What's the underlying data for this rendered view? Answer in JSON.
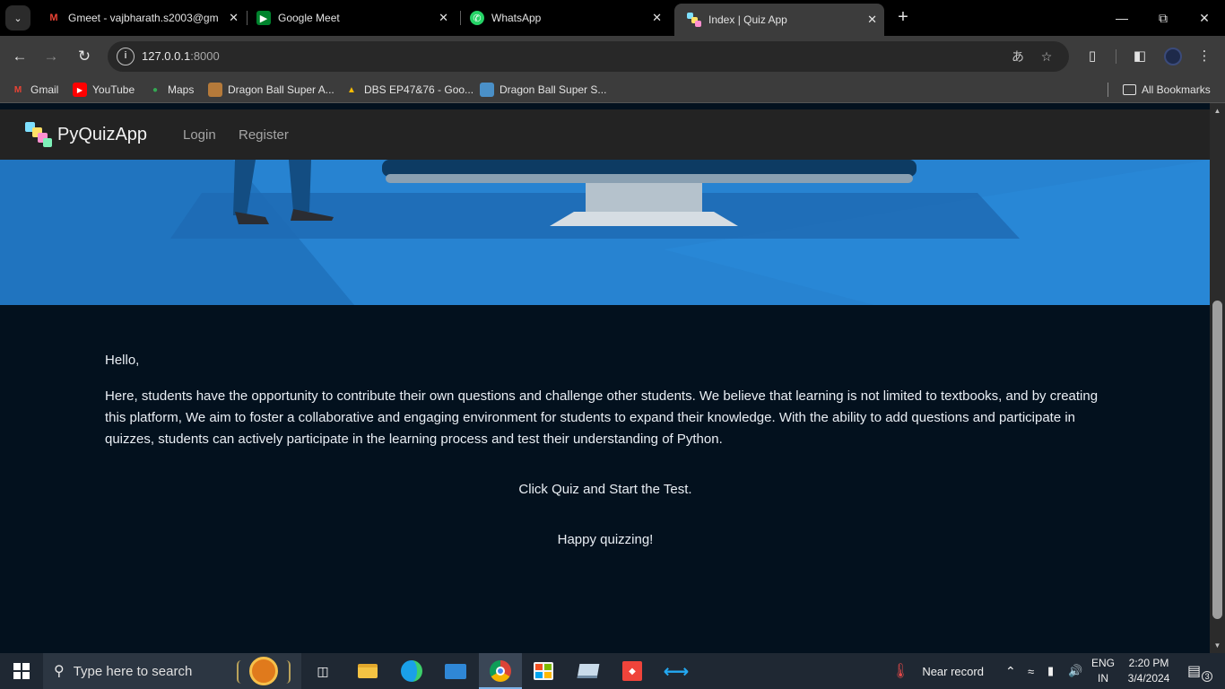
{
  "browser": {
    "tabs": [
      {
        "title": "Gmeet - vajbharath.s2003@gma",
        "favicon": "gmail-icon",
        "active": false
      },
      {
        "title": "Google Meet",
        "favicon": "google-meet-icon",
        "active": false
      },
      {
        "title": "WhatsApp",
        "favicon": "whatsapp-icon",
        "active": false
      },
      {
        "title": "Index | Quiz App",
        "favicon": "quiz-app-icon",
        "active": true
      }
    ],
    "address": {
      "host": "127.0.0.1",
      "port": ":8000"
    },
    "bookmarks": [
      {
        "label": "Gmail",
        "icon": "gmail-icon"
      },
      {
        "label": "YouTube",
        "icon": "youtube-icon"
      },
      {
        "label": "Maps",
        "icon": "maps-icon"
      },
      {
        "label": "Dragon Ball Super A...",
        "icon": "image-icon"
      },
      {
        "label": "DBS EP47&76 - Goo...",
        "icon": "google-drive-icon"
      },
      {
        "label": "Dragon Ball Super S...",
        "icon": "site-icon"
      }
    ],
    "all_bookmarks_label": "All Bookmarks"
  },
  "page": {
    "brand": "PyQuizApp",
    "nav": {
      "login": "Login",
      "register": "Register"
    },
    "greeting": "Hello,",
    "intro": "Here, students have the opportunity to contribute their own questions and challenge other students. We believe that learning is not limited to textbooks, and by creating this platform, We aim to foster a collaborative and engaging environment for students to expand their knowledge. With the ability to add questions and participate in quizzes, students can actively participate in the learning process and test their understanding of Python.",
    "cta": "Click Quiz and Start the Test.",
    "signoff": "Happy quizzing!"
  },
  "taskbar": {
    "search_placeholder": "Type here to search",
    "weather": "Near record",
    "lang_line1": "ENG",
    "lang_line2": "IN",
    "time": "2:20 PM",
    "date": "3/4/2024",
    "notification_count": "3"
  },
  "colors": {
    "page_bg": "#03111e",
    "navbar_bg": "#232323",
    "hero_blue": "#2783d1",
    "text": "#e9eef4"
  }
}
